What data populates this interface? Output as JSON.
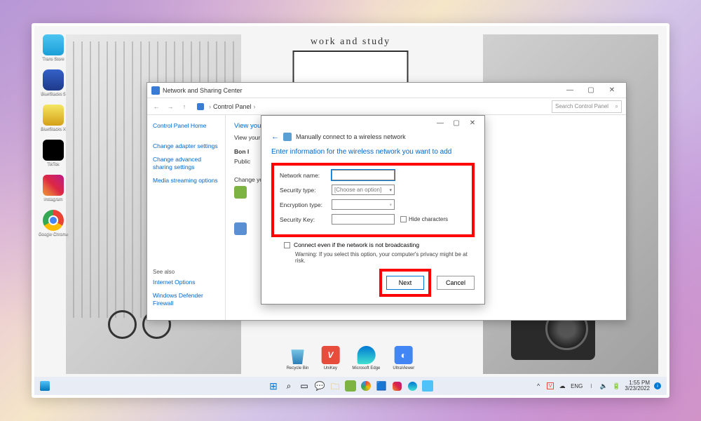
{
  "wallpaper": {
    "title": "work and study"
  },
  "desktop_icons": [
    {
      "label": "Trans Store"
    },
    {
      "label": "BlueStacks 5"
    },
    {
      "label": "BlueStacks X"
    },
    {
      "label": "TikTok"
    },
    {
      "label": "Instagram"
    },
    {
      "label": "Google Chrome"
    }
  ],
  "middle_icons": [
    {
      "label": "Recycle Bin"
    },
    {
      "label": "UniKey"
    },
    {
      "label": "Microsoft Edge"
    },
    {
      "label": "UltraViewer"
    }
  ],
  "ns_window": {
    "title": "Network and Sharing Center",
    "breadcrumb_root": "Control Panel",
    "search_placeholder": "Search Control Panel",
    "sidebar": {
      "home": "Control Panel Home",
      "adapter": "Change adapter settings",
      "advanced": "Change advanced sharing settings",
      "media": "Media streaming options"
    },
    "see_also": {
      "header": "See also",
      "internet": "Internet Options",
      "firewall": "Windows Defender Firewall"
    },
    "main": {
      "view_title": "View your",
      "view_sub": "View your",
      "bon_label": "Bon I",
      "public_label": "Public",
      "change_title": "Change your"
    }
  },
  "dialog": {
    "title": "Manually connect to a wireless network",
    "instruction": "Enter information for the wireless network you want to add",
    "labels": {
      "network_name": "Network name:",
      "security_type": "Security type:",
      "encryption_type": "Encryption type:",
      "security_key": "Security Key:"
    },
    "security_placeholder": "[Choose an option]",
    "hide_characters": "Hide characters",
    "broadcast": "Connect even if the network is not broadcasting",
    "warning": "Warning: If you select this option, your computer's privacy might be at risk.",
    "next": "Next",
    "cancel": "Cancel"
  },
  "taskbar": {
    "lang": "ENG",
    "time": "1:55 PM",
    "date": "3/23/2022",
    "v_indicator": "V"
  }
}
